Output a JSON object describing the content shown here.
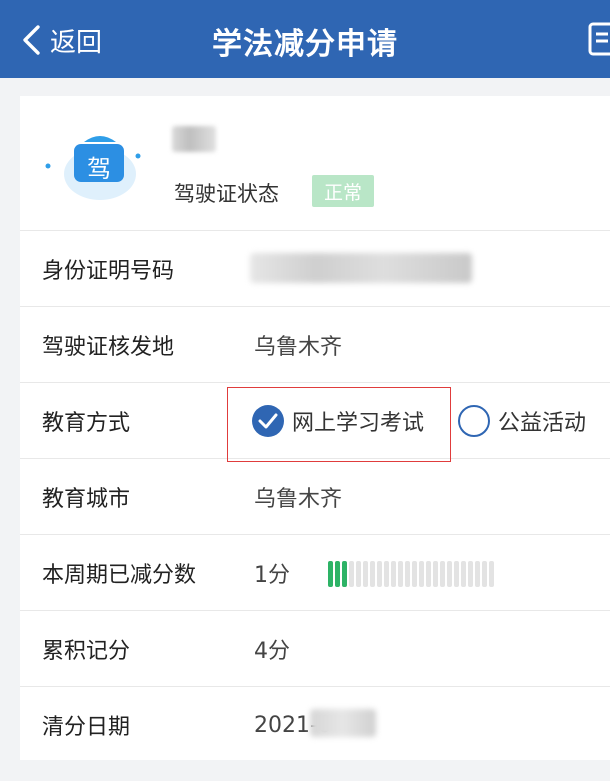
{
  "header": {
    "back_label": "返回",
    "title": "学法减分申请"
  },
  "profile": {
    "avatar_char": "驾",
    "status_label": "驾驶证状态",
    "status_value": "正常"
  },
  "rows": {
    "id_number": {
      "label": "身份证明号码",
      "value": ""
    },
    "license_origin": {
      "label": "驾驶证核发地",
      "value": "乌鲁木齐"
    },
    "education_method": {
      "label": "教育方式",
      "options": [
        {
          "label": "网上学习考试",
          "selected": true
        },
        {
          "label": "公益活动",
          "selected": false
        }
      ]
    },
    "education_city": {
      "label": "教育城市",
      "value": "乌鲁木齐"
    },
    "points_reduced": {
      "label": "本周期已减分数",
      "value": "1分",
      "progress_filled": 3,
      "progress_total": 24
    },
    "accumulated": {
      "label": "累积记分",
      "value": "4分"
    },
    "clear_date": {
      "label": "清分日期",
      "value": "2021-0"
    }
  },
  "colors": {
    "primary": "#2f66b3",
    "status_green": "#b9e6c7",
    "progress_green": "#2db366",
    "highlight_red": "#e03c3c"
  },
  "icons": {
    "back": "chevron-left-icon",
    "menu": "document-icon",
    "avatar": "driver-license-icon",
    "check": "check-icon"
  }
}
